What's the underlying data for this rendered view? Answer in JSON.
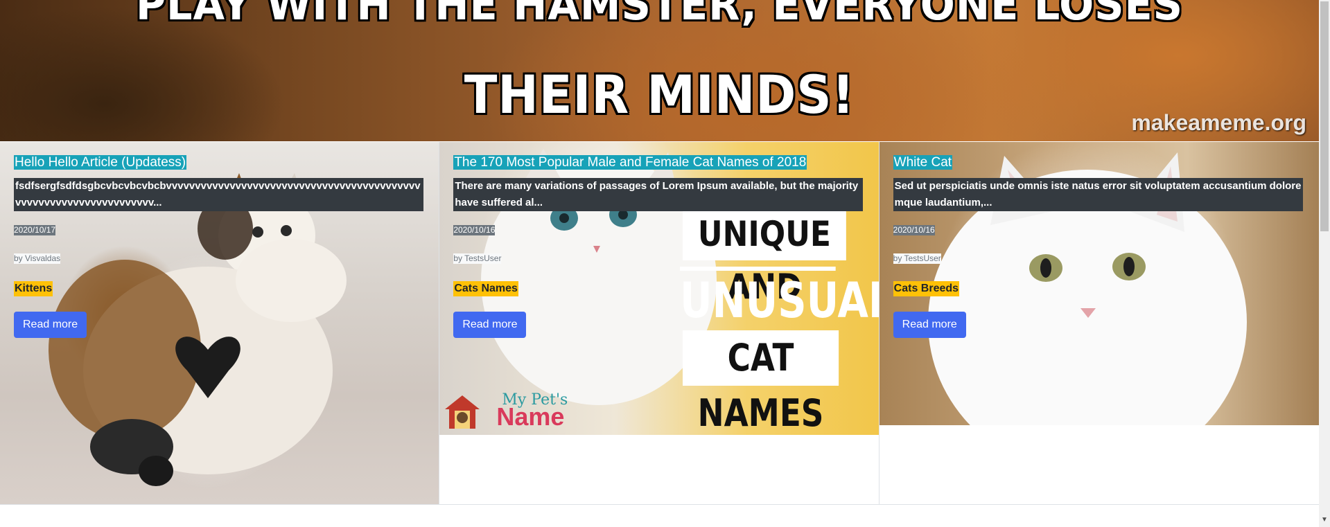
{
  "hero": {
    "line1": "PLAY WITH THE HAMSTER, EVERYONE LOSES",
    "line2": "THEIR MINDS!",
    "watermark": "makeameme.org"
  },
  "cards": [
    {
      "title": "Hello Hello Article (Updatess)",
      "description": "fsdfsergfsdfdsgbcvbcvbcvbcbvvvvvvvvvvvvvvvvvvvvvvvvvvvvvvvvvvvvvvvvvvvvvvvvvvvvvvvvvvvvvvvvvvvv...",
      "date": "2020/10/17",
      "author": "by Visvaldas",
      "category": "Kittens",
      "button": "Read more"
    },
    {
      "title": "The 170 Most Popular Male and Female Cat Names of 2018",
      "description": "There are many variations of passages of Lorem Ipsum available, but the majority have suffered al...",
      "date": "2020/10/16",
      "author": "by TestsUser",
      "category": "Cats Names",
      "button": "Read more",
      "image_text": {
        "line1": "UNIQUE AND",
        "line2": "UNUSUAL",
        "line3": "CAT NAMES",
        "logo_top": "My Pet's",
        "logo_bottom": "Name"
      }
    },
    {
      "title": "White Cat",
      "description": "Sed ut perspiciatis unde omnis iste natus error sit voluptatem accusantium doloremque laudantium,...",
      "date": "2020/10/16",
      "author": "by TestsUser",
      "category": "Cats Breeds",
      "button": "Read more"
    }
  ],
  "colors": {
    "title_bg": "#17a2b8",
    "description_bg": "#343a40",
    "date_bg": "#6c757d",
    "category_bg": "#ffc107",
    "button_bg": "#4169f0"
  }
}
